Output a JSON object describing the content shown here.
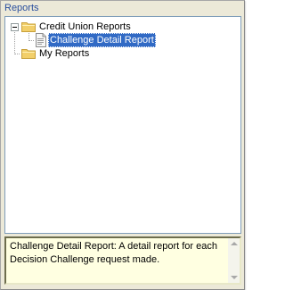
{
  "panel": {
    "title": "Reports"
  },
  "tree": {
    "nodes": [
      {
        "label": "Credit Union Reports",
        "expanded": true,
        "icon": "folder-icon"
      },
      {
        "label": "Challenge Detail Report",
        "selected": true,
        "icon": "report-document-icon"
      },
      {
        "label": "My Reports",
        "icon": "folder-icon"
      }
    ]
  },
  "description": {
    "text": "Challenge Detail Report: A detail report for each Decision Challenge request made."
  },
  "colors": {
    "title_text": "#2a4f9e",
    "selection": "#316ac5",
    "description_bg": "#ffffe1",
    "folder": "#f2cf6a"
  }
}
